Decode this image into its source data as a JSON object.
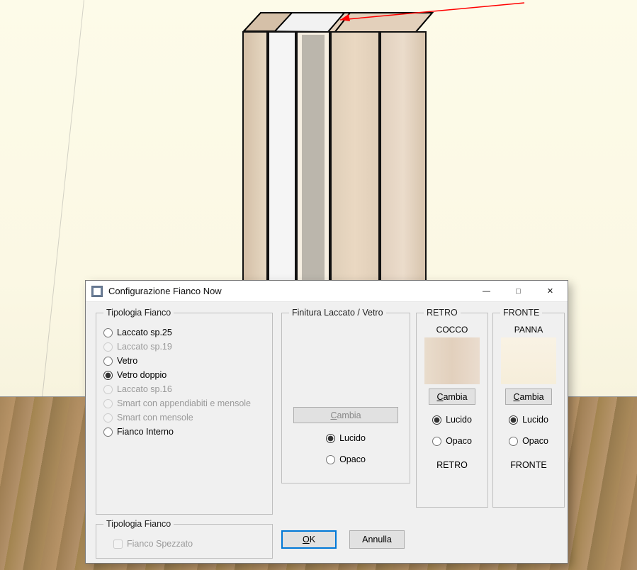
{
  "dialog": {
    "title": "Configurazione Fianco Now",
    "groups": {
      "tipologia": {
        "legend": "Tipologia Fianco",
        "options": [
          {
            "label": "Laccato sp.25",
            "enabled": true,
            "selected": false
          },
          {
            "label": "Laccato sp.19",
            "enabled": false,
            "selected": false
          },
          {
            "label": "Vetro",
            "enabled": true,
            "selected": false
          },
          {
            "label": "Vetro doppio",
            "enabled": true,
            "selected": true
          },
          {
            "label": "Laccato sp.16",
            "enabled": false,
            "selected": false
          },
          {
            "label": "Smart con appendiabiti e mensole",
            "enabled": false,
            "selected": false
          },
          {
            "label": "Smart con mensole",
            "enabled": false,
            "selected": false
          },
          {
            "label": "Fianco Interno",
            "enabled": true,
            "selected": false
          }
        ]
      },
      "tipologia2": {
        "legend": "Tipologia Fianco",
        "checkbox": {
          "label": "Fianco Spezzato",
          "enabled": false,
          "checked": false
        }
      },
      "finitura": {
        "legend": "Finitura Laccato / Vetro",
        "change_label": "Cambia",
        "change_enabled": false,
        "opts": {
          "lucido": "Lucido",
          "opaco": "Opaco",
          "selected": "lucido"
        }
      },
      "retro": {
        "heading": "RETRO",
        "material": "COCCO",
        "change_label": "Cambia",
        "opts": {
          "lucido": "Lucido",
          "opaco": "Opaco",
          "selected": "lucido"
        },
        "caption": "RETRO"
      },
      "fronte": {
        "heading": "FRONTE",
        "material": "PANNA",
        "change_label": "Cambia",
        "opts": {
          "lucido": "Lucido",
          "opaco": "Opaco",
          "selected": "lucido"
        },
        "caption": "FRONTE"
      }
    },
    "buttons": {
      "ok": "OK",
      "cancel": "Annulla"
    }
  }
}
